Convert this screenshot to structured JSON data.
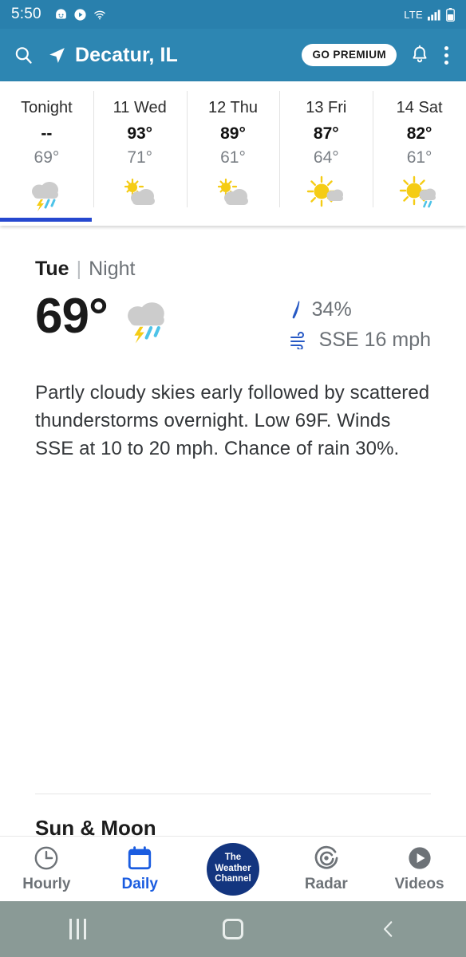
{
  "status_bar": {
    "time": "5:50",
    "network": "LTE",
    "icons": [
      "messaging-icon",
      "play-icon",
      "wifi-icon",
      "signal-icon",
      "battery-icon"
    ]
  },
  "app_bar": {
    "location": "Decatur, IL",
    "premium_label": "GO PREMIUM",
    "icons": [
      "search-icon",
      "location-arrow-icon",
      "bell-icon",
      "overflow-menu-icon"
    ]
  },
  "forecast": {
    "active_index": 0,
    "cards": [
      {
        "day": "Tonight",
        "high": "--",
        "low": "69°",
        "icon": "thunderstorm"
      },
      {
        "day": "11 Wed",
        "high": "93°",
        "low": "71°",
        "icon": "sun-behind-cloud"
      },
      {
        "day": "12 Thu",
        "high": "89°",
        "low": "61°",
        "icon": "sun-behind-cloud"
      },
      {
        "day": "13 Fri",
        "high": "87°",
        "low": "64°",
        "icon": "sun-small-cloud"
      },
      {
        "day": "14 Sat",
        "high": "82°",
        "low": "61°",
        "icon": "sun-cloud-rain"
      }
    ]
  },
  "detail": {
    "day": "Tue",
    "separator": "|",
    "day_part": "Night",
    "temperature": "69°",
    "icon": "thunderstorm",
    "precip_value": "34%",
    "wind_value": "SSE 16 mph",
    "description": "Partly cloudy skies early followed by scattered thunderstorms overnight. Low 69F. Winds SSE at 10 to 20 mph. Chance of rain 30%."
  },
  "sun_moon": {
    "title": "Sun & Moon"
  },
  "bottom_nav": {
    "active": "Daily",
    "items": [
      {
        "label": "Hourly",
        "icon": "clock-icon"
      },
      {
        "label": "Daily",
        "icon": "calendar-icon"
      },
      {
        "label": "",
        "icon": "weather-channel-logo"
      },
      {
        "label": "Radar",
        "icon": "radar-icon"
      },
      {
        "label": "Videos",
        "icon": "video-play-icon"
      }
    ],
    "logo_lines": [
      "The",
      "Weather",
      "Channel"
    ]
  },
  "system_nav": {
    "buttons": [
      "recents-button",
      "home-button",
      "back-button"
    ]
  },
  "colors": {
    "header_blue": "#2d86b2",
    "status_blue": "#2980ad",
    "tab_indicator": "#2548cf",
    "accent_blue": "#1a5ce0",
    "logo_navy": "#13357f",
    "sysnav_gray": "#8a9a96"
  }
}
